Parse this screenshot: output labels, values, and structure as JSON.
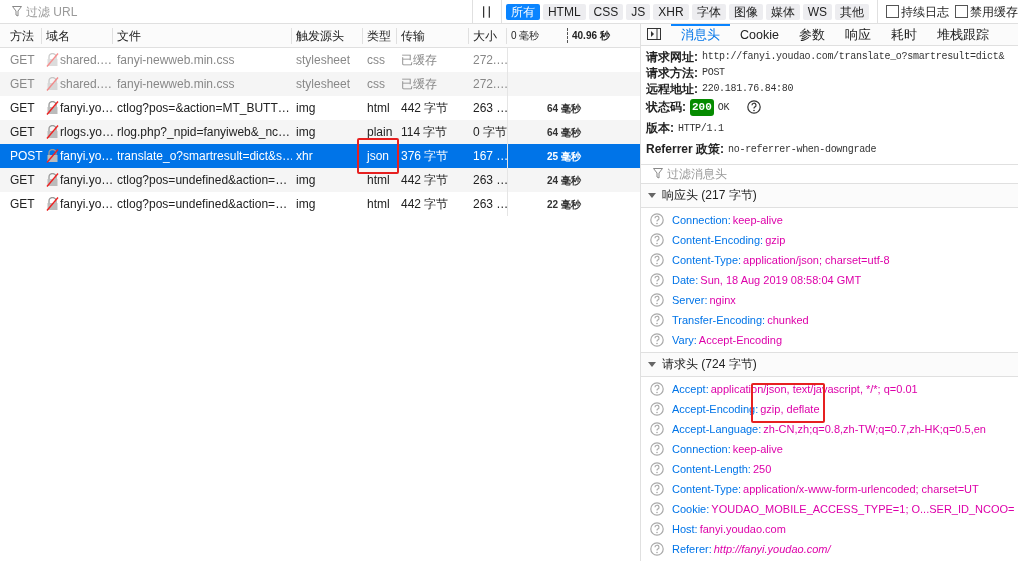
{
  "toolbar": {
    "filter": {
      "placeholder": "过滤 URL"
    },
    "type_filters": [
      {
        "label": "所有",
        "selected": true
      },
      {
        "label": "HTML",
        "selected": false
      },
      {
        "label": "CSS",
        "selected": false
      },
      {
        "label": "JS",
        "selected": false
      },
      {
        "label": "XHR",
        "selected": false
      },
      {
        "label": "字体",
        "selected": false
      },
      {
        "label": "图像",
        "selected": false
      },
      {
        "label": "媒体",
        "selected": false
      },
      {
        "label": "WS",
        "selected": false
      },
      {
        "label": "其他",
        "selected": false
      }
    ],
    "options": [
      {
        "label": "持续日志",
        "checked": false
      },
      {
        "label": "禁用缓存",
        "checked": false
      }
    ]
  },
  "table": {
    "columns": [
      "方法",
      "域名",
      "文件",
      "触发源头",
      "类型",
      "传输",
      "大小"
    ],
    "timeline": {
      "start": "0 毫秒",
      "end": "40.96 秒"
    },
    "rows": [
      {
        "method": "GET",
        "domain": "shared.…",
        "file": "fanyi-newweb.min.css",
        "cause": "stylesheet",
        "type": "css",
        "transferred": "已缓存",
        "size": "272.…",
        "cached": true,
        "selected": false,
        "highlighted": false
      },
      {
        "method": "GET",
        "domain": "shared.…",
        "file": "fanyi-newweb.min.css",
        "cause": "stylesheet",
        "type": "css",
        "transferred": "已缓存",
        "size": "272.…",
        "cached": true,
        "selected": false,
        "highlighted": false
      },
      {
        "method": "GET",
        "domain": "fanyi.yo…",
        "file": "ctlog?pos=&action=MT_BUTT…",
        "cause": "img",
        "type": "html",
        "transferred": "442 字节",
        "size": "263 …",
        "time": "64 毫秒",
        "cached": false,
        "selected": false,
        "highlighted": false
      },
      {
        "method": "GET",
        "domain": "rlogs.yo…",
        "file": "rlog.php?_npid=fanyiweb&_nc…",
        "cause": "img",
        "type": "plain",
        "transferred": "114 字节",
        "size": "0 字节",
        "time": "64 毫秒",
        "cached": false,
        "selected": false,
        "highlighted": false
      },
      {
        "method": "POST",
        "domain": "fanyi.yo…",
        "file": "translate_o?smartresult=dict&s…",
        "cause": "xhr",
        "type": "json",
        "transferred": "376 字节",
        "size": "167 …",
        "time": "25 毫秒",
        "cached": false,
        "selected": true,
        "highlighted": true
      },
      {
        "method": "GET",
        "domain": "fanyi.yo…",
        "file": "ctlog?pos=undefined&action=…",
        "cause": "img",
        "type": "html",
        "transferred": "442 字节",
        "size": "263 …",
        "time": "24 毫秒",
        "cached": false,
        "selected": false,
        "highlighted": false
      },
      {
        "method": "GET",
        "domain": "fanyi.yo…",
        "file": "ctlog?pos=undefined&action=…",
        "cause": "img",
        "type": "html",
        "transferred": "442 字节",
        "size": "263 …",
        "time": "22 毫秒",
        "cached": false,
        "selected": false,
        "highlighted": false
      }
    ]
  },
  "details": {
    "tabs": [
      {
        "label": "消息头",
        "selected": true
      },
      {
        "label": "Cookie",
        "selected": false
      },
      {
        "label": "参数",
        "selected": false
      },
      {
        "label": "响应",
        "selected": false
      },
      {
        "label": "耗时",
        "selected": false
      },
      {
        "label": "堆栈跟踪",
        "selected": false
      }
    ],
    "summary": [
      {
        "label": "请求网址:",
        "value": "http://fanyi.youdao.com/translate_o?smartresult=dict&",
        "kind": "text"
      },
      {
        "label": "请求方法:",
        "value": "POST",
        "kind": "text"
      },
      {
        "label": "远程地址:",
        "value": "220.181.76.84:80",
        "kind": "text"
      },
      {
        "label": "状态码:",
        "code": "200",
        "value": "OK",
        "kind": "status"
      },
      {
        "label": "版本:",
        "value": "HTTP/1.1",
        "kind": "text"
      },
      {
        "label": "Referrer 政策:",
        "value": "no-referrer-when-downgrade",
        "kind": "text"
      }
    ],
    "filter": {
      "placeholder": "过滤消息头"
    },
    "sections": [
      {
        "title": "响应头 (217 字节)",
        "expanded": true,
        "highlight_box": false,
        "headers": [
          {
            "name": "Connection:",
            "value": "keep-alive",
            "kind": "text"
          },
          {
            "name": "Content-Encoding:",
            "value": "gzip",
            "kind": "text"
          },
          {
            "name": "Content-Type:",
            "value": "application/json; charset=utf-8",
            "kind": "text"
          },
          {
            "name": "Date:",
            "value": "Sun, 18 Aug 2019 08:58:04 GMT",
            "kind": "text"
          },
          {
            "name": "Server:",
            "value": "nginx",
            "kind": "text"
          },
          {
            "name": "Transfer-Encoding:",
            "value": "chunked",
            "kind": "text"
          },
          {
            "name": "Vary:",
            "value": "Accept-Encoding",
            "kind": "text"
          }
        ]
      },
      {
        "title": "请求头 (724 字节)",
        "expanded": true,
        "highlight_box": true,
        "headers": [
          {
            "name": "Accept:",
            "value": "application/json, text/javascript, */*; q=0.01",
            "kind": "text"
          },
          {
            "name": "Accept-Encoding:",
            "value": "gzip, deflate",
            "kind": "text"
          },
          {
            "name": "Accept-Language:",
            "value": "zh-CN,zh;q=0.8,zh-TW;q=0.7,zh-HK;q=0.5,en",
            "kind": "text"
          },
          {
            "name": "Connection:",
            "value": "keep-alive",
            "kind": "text"
          },
          {
            "name": "Content-Length:",
            "value": "250",
            "kind": "text"
          },
          {
            "name": "Content-Type:",
            "value": "application/x-www-form-urlencoded; charset=UT",
            "kind": "text"
          },
          {
            "name": "Cookie:",
            "value": "YOUDAO_MOBILE_ACCESS_TYPE=1; O...SER_ID_NCOO=",
            "kind": "text"
          },
          {
            "name": "Host:",
            "value": "fanyi.youdao.com",
            "kind": "text"
          },
          {
            "name": "Referer:",
            "value": "http://fanyi.youdao.com/",
            "kind": "link"
          }
        ]
      }
    ]
  }
}
